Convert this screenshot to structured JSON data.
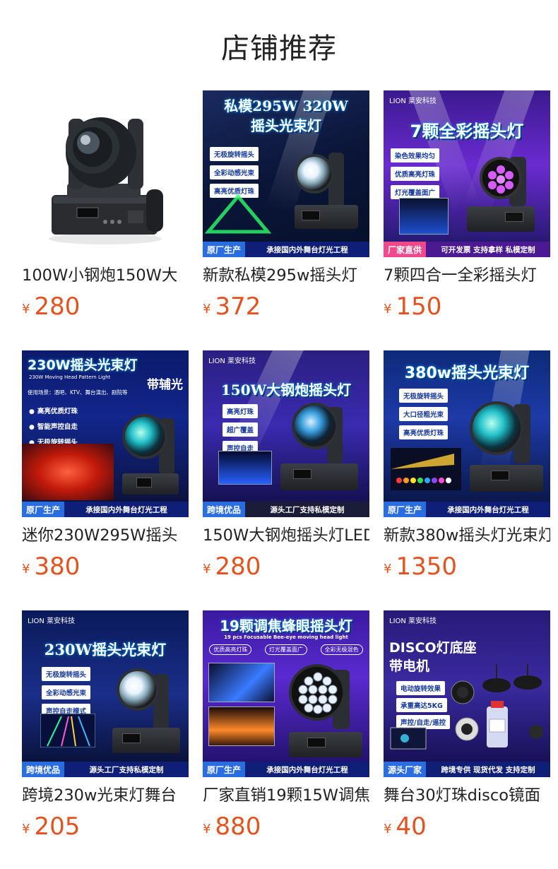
{
  "page": {
    "title": "店铺推荐"
  },
  "currency": "¥",
  "products": [
    {
      "name": "100W小钢炮150W大",
      "price": "280",
      "image": {
        "style": "white"
      }
    },
    {
      "name": "新款私模295w摇头灯",
      "price": "372",
      "image": {
        "headline1": "私模295W 320W",
        "headline2": "摇头光束灯",
        "features": [
          "无极旋转摇头",
          "全彩动感光束",
          "高亮优质灯珠"
        ],
        "tag": "原厂生产",
        "band": "承接国内外舞台灯光工程"
      }
    },
    {
      "name": "7颗四合一全彩摇头灯",
      "price": "150",
      "image": {
        "brand": "LION 莱安科技",
        "headline1": "7颗全彩摇头灯",
        "features": [
          "染色效果均匀",
          "优质高亮灯珠",
          "灯光覆盖面广"
        ],
        "tag": "厂家直供",
        "band": "可开发票  支持拿样  私模定制"
      }
    },
    {
      "name": "迷你230W295W摇头",
      "price": "380",
      "image": {
        "headline1": "230W摇头光束灯",
        "subline": "230W Moving Head Pattern Light",
        "note": "使用场景：酒吧、KTV、舞台演出、剧院等",
        "side": "带辅光",
        "features": [
          "高亮优质灯珠",
          "智能声控自走",
          "无极旋转摇头"
        ],
        "tag": "原厂生产",
        "band": "承接国内外舞台灯光工程"
      }
    },
    {
      "name": "150W大钢炮摇头灯LED",
      "price": "280",
      "image": {
        "brand": "LION 莱安科技",
        "headline1": "150W大钢炮摇头灯",
        "features": [
          "高亮灯珠",
          "超广覆盖",
          "声控自走"
        ],
        "tag": "跨境优品",
        "band": "源头工厂支持私模定制"
      }
    },
    {
      "name": "新款380w摇头灯光束灯",
      "price": "1350",
      "image": {
        "headline1": "380w摇头光束灯",
        "features": [
          "无极旋转摇头",
          "大口径粗光束",
          "高亮优质灯珠"
        ],
        "tag": "原厂生产",
        "band": "承接国内外舞台灯光工程"
      }
    },
    {
      "name": "跨境230w光束灯舞台",
      "price": "205",
      "image": {
        "brand": "LION 莱安科技",
        "headline1": "230W摇头光束灯",
        "features": [
          "无极旋转摇头",
          "全彩动感光束",
          "声控自走模式"
        ],
        "tag": "跨境优品",
        "band": "源头工厂支持私模定制"
      }
    },
    {
      "name": "厂家直销19颗15W调焦",
      "price": "880",
      "image": {
        "headline1": "19颗调焦蜂眼摇头灯",
        "subline": "19 pcs Focusable Bee-eye moving head light",
        "features": [
          "优质高亮灯珠",
          "灯光覆盖面广",
          "全彩无极混色"
        ],
        "tag": "原厂生产",
        "band": "承接国内外舞台灯光工程"
      }
    },
    {
      "name": "舞台30灯珠disco镜面",
      "price": "40",
      "image": {
        "brand": "LION 莱安科技",
        "headline1": "DISCO灯底座",
        "headline2": "带电机",
        "features": [
          "电动旋转效果",
          "承重高达5KG",
          "声控/自走/遥控"
        ],
        "tag": "源头厂家",
        "band": "跨境专供  现货代发  支持定制"
      }
    }
  ]
}
